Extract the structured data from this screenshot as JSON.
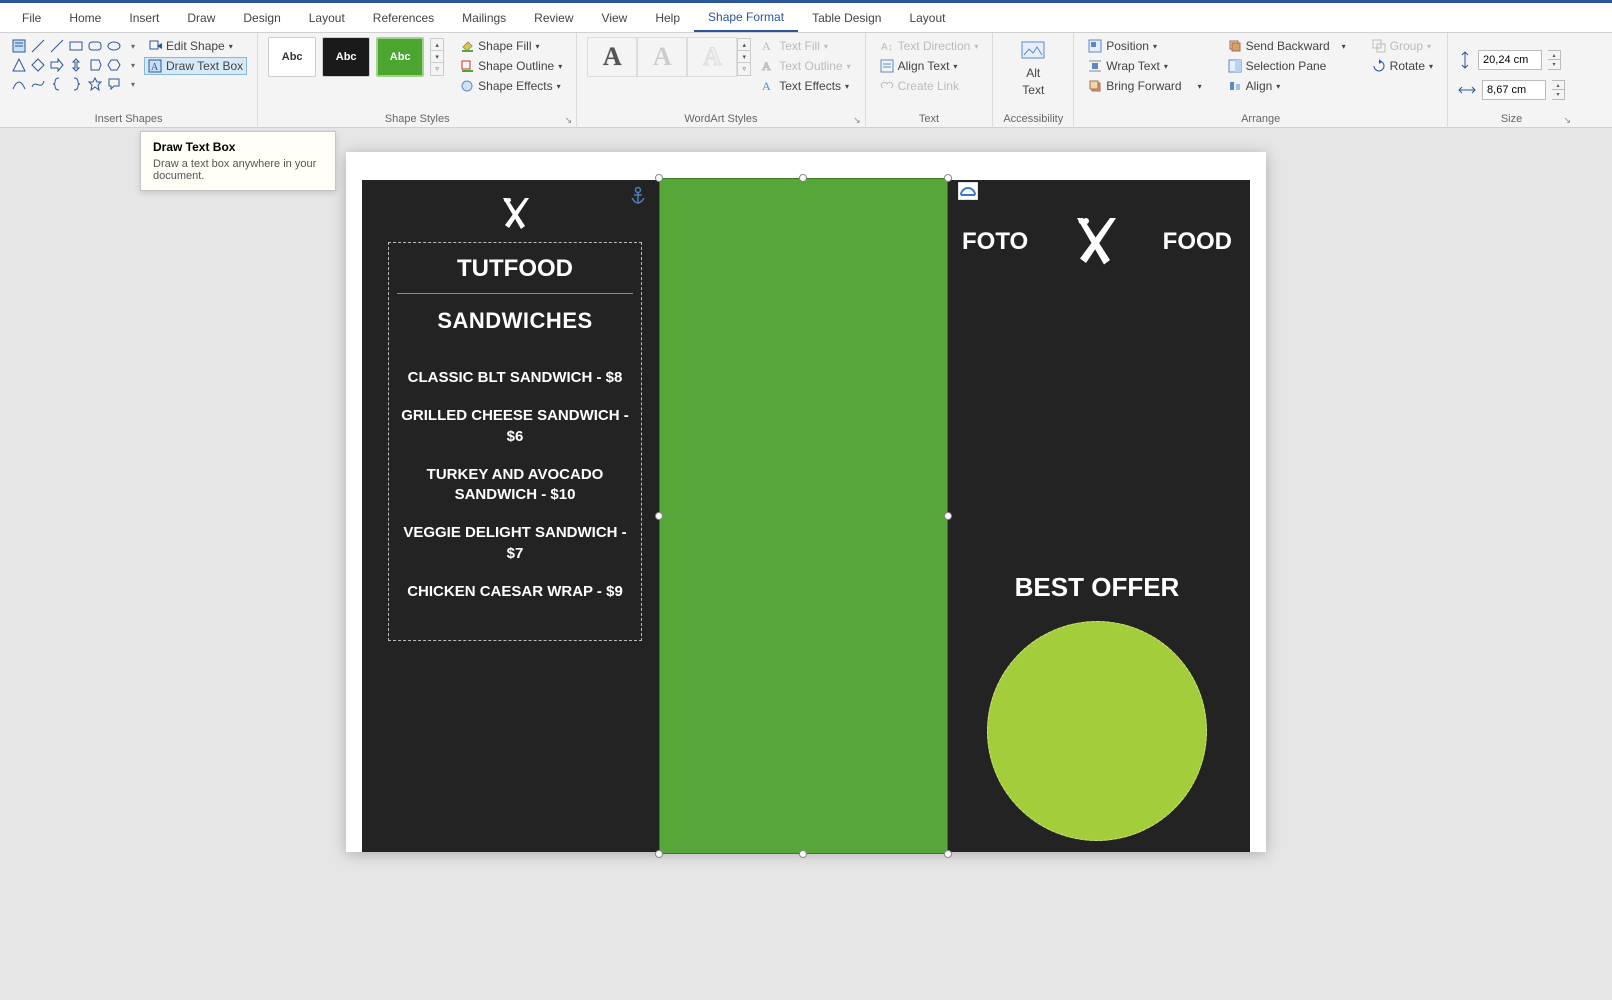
{
  "menu": {
    "tabs": [
      "File",
      "Home",
      "Insert",
      "Draw",
      "Design",
      "Layout",
      "References",
      "Mailings",
      "Review",
      "View",
      "Help",
      "Shape Format",
      "Table Design",
      "Layout"
    ],
    "active": "Shape Format"
  },
  "ribbon": {
    "insert_shapes": {
      "label": "Insert Shapes",
      "edit_shape": "Edit Shape",
      "draw_text_box": "Draw Text Box"
    },
    "shape_styles": {
      "label": "Shape Styles",
      "swatch_text": "Abc",
      "shape_fill": "Shape Fill",
      "shape_outline": "Shape Outline",
      "shape_effects": "Shape Effects"
    },
    "wordart_styles": {
      "label": "WordArt Styles",
      "glyph": "A",
      "text_fill": "Text Fill",
      "text_outline": "Text Outline",
      "text_effects": "Text Effects"
    },
    "text": {
      "label": "Text",
      "text_direction": "Text Direction",
      "align_text": "Align Text",
      "create_link": "Create Link"
    },
    "accessibility": {
      "label": "Accessibility",
      "alt_text_1": "Alt",
      "alt_text_2": "Text"
    },
    "arrange": {
      "label": "Arrange",
      "position": "Position",
      "wrap_text": "Wrap Text",
      "bring_forward": "Bring Forward",
      "send_backward": "Send Backward",
      "selection_pane": "Selection Pane",
      "align": "Align",
      "group": "Group",
      "rotate": "Rotate"
    },
    "size": {
      "label": "Size",
      "height": "20,24 cm",
      "width": "8,67 cm"
    }
  },
  "tooltip": {
    "title": "Draw Text Box",
    "body": "Draw a text box anywhere in your document."
  },
  "document": {
    "panel1": {
      "brand": "TUTFOOD",
      "category": "SANDWICHES",
      "items": [
        "CLASSIC BLT SANDWICH - $8",
        "GRILLED CHEESE SANDWICH - $6",
        "TURKEY AND AVOCADO SANDWICH - $10",
        "VEGGIE DELIGHT SANDWICH - $7",
        "CHICKEN CAESAR WRAP - $9"
      ]
    },
    "panel3": {
      "left": "FOTO",
      "right": "FOOD",
      "offer": "BEST OFFER"
    }
  }
}
